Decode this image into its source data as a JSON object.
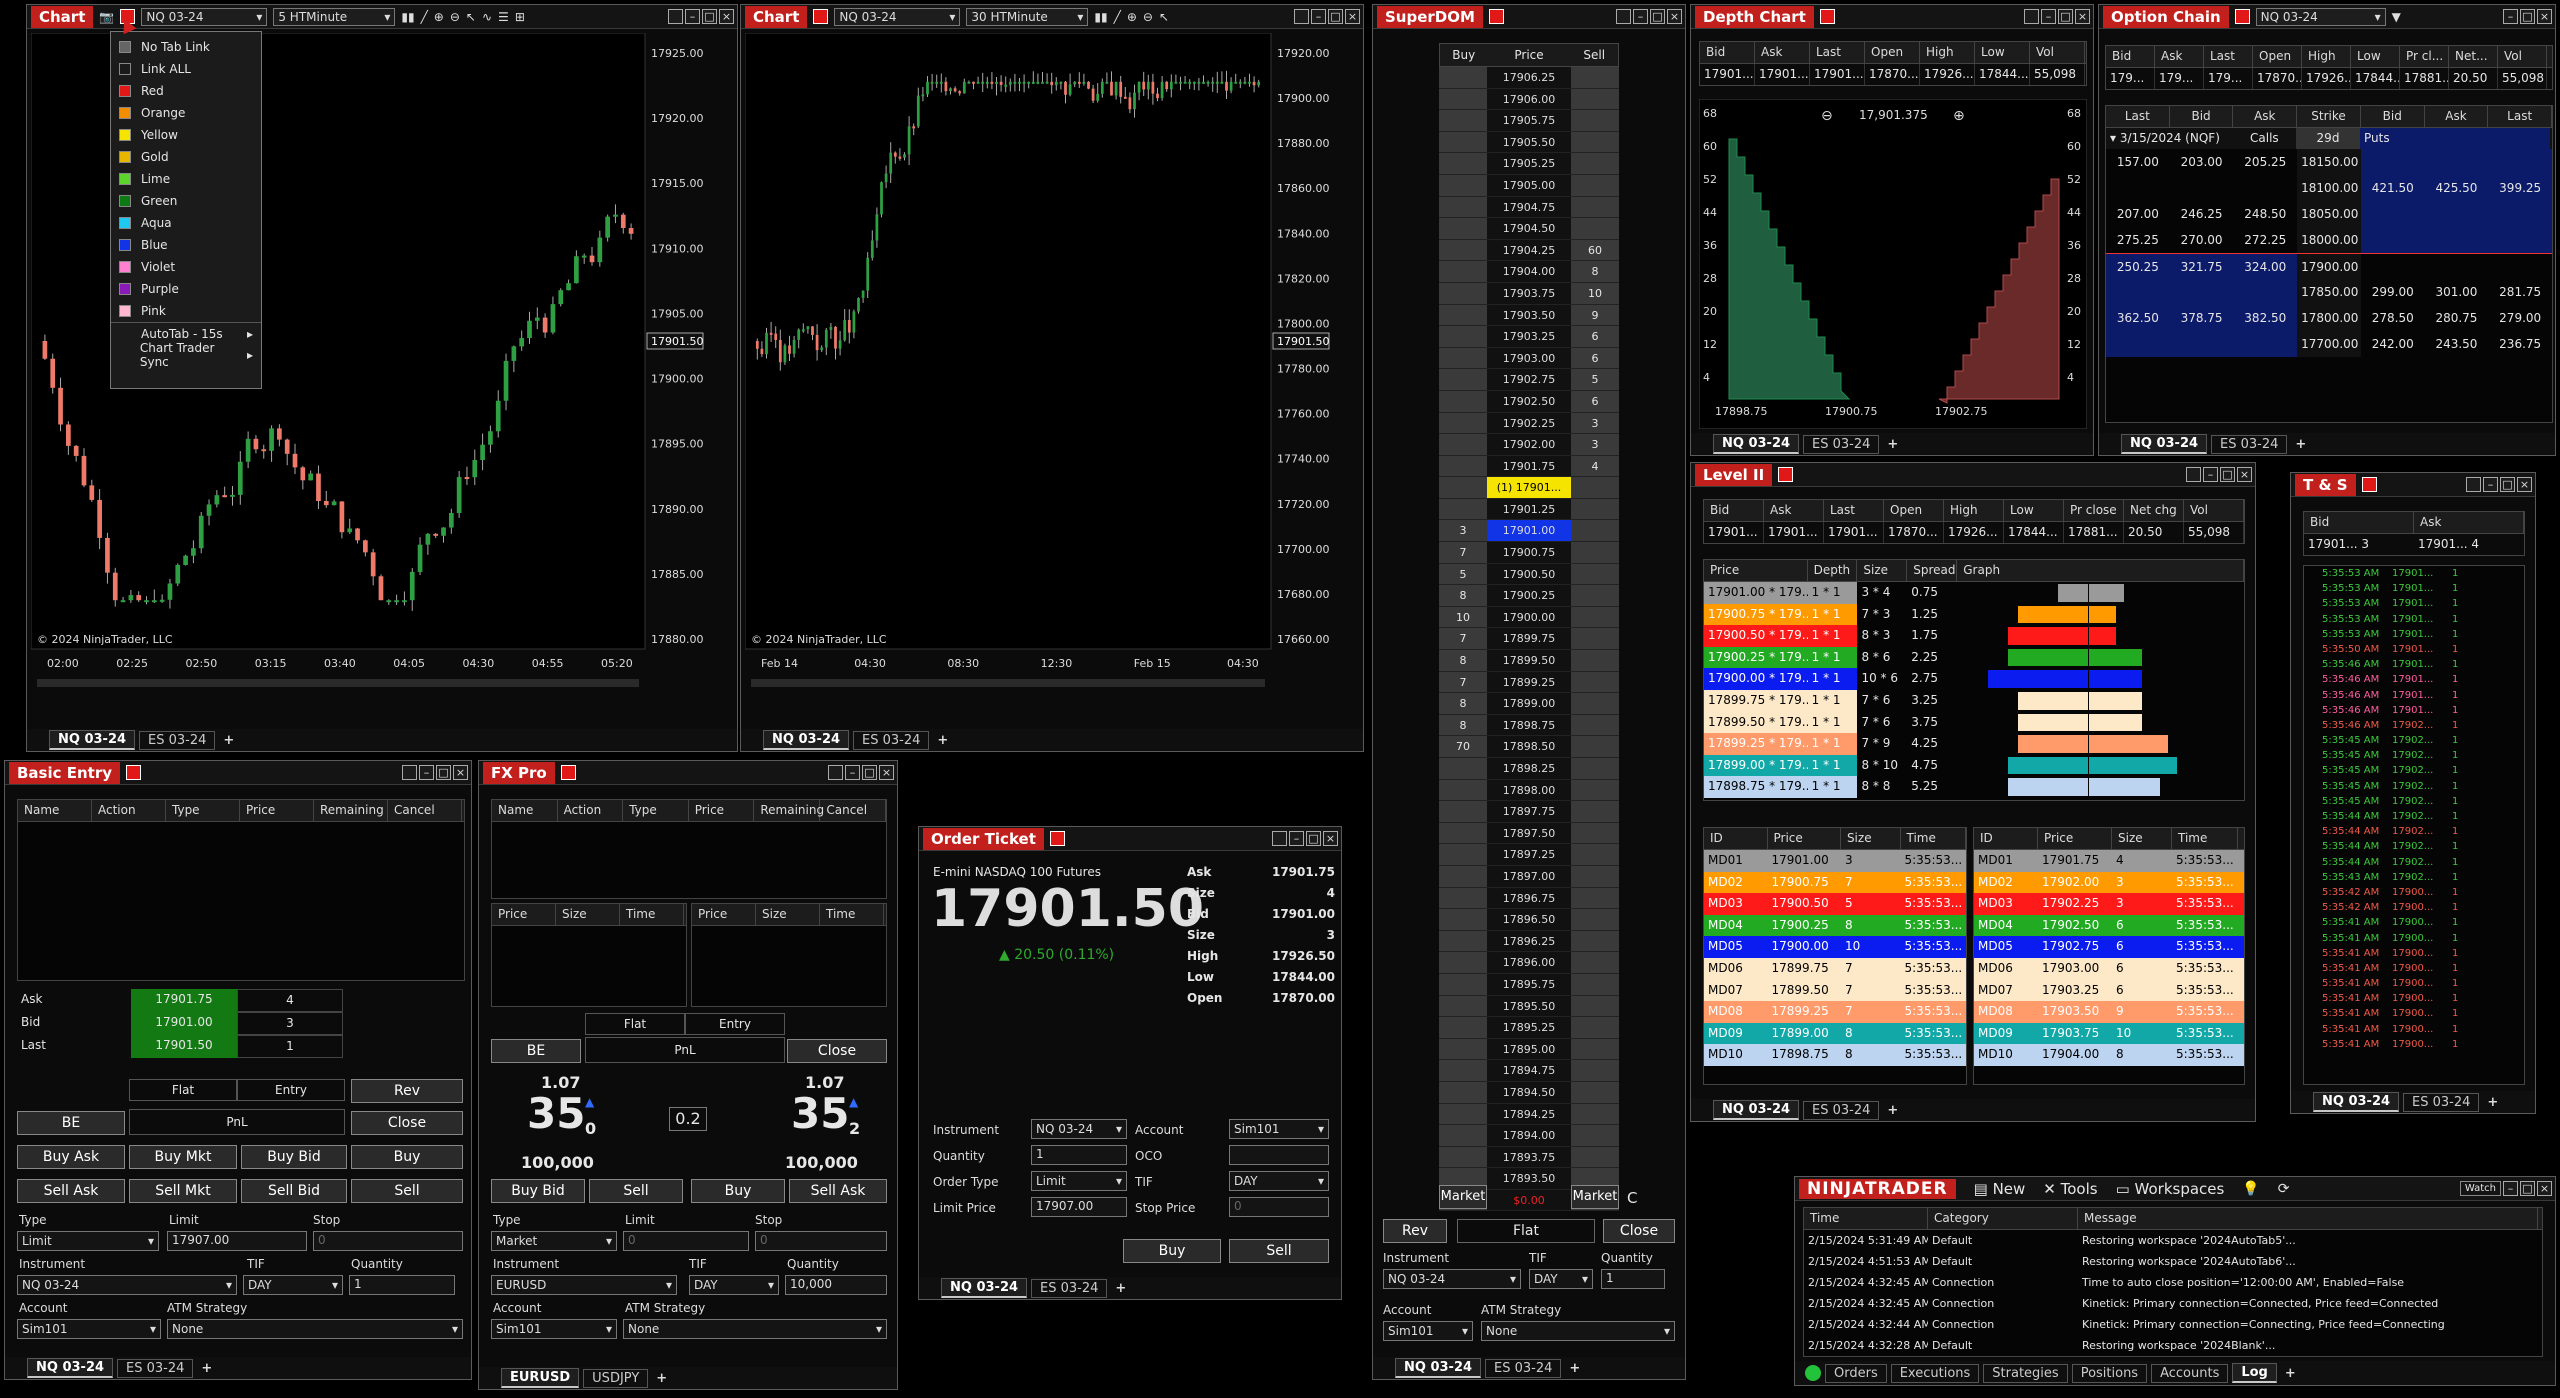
{
  "chart1": {
    "title": "Chart",
    "instrument": "NQ 03-24",
    "interval": "5 HTMinute",
    "copyright": "© 2024 NinjaTrader, LLC",
    "price_ticks": [
      "17925.00",
      "17920.00",
      "17915.00",
      "17910.00",
      "17905.00",
      "17900.00",
      "17895.00",
      "17890.00",
      "17885.00",
      "17880.00"
    ],
    "current": "17901.50",
    "time_ticks": [
      "02:00",
      "02:25",
      "02:50",
      "03:15",
      "03:40",
      "04:05",
      "04:30",
      "04:55",
      "05:20"
    ],
    "tabs": [
      "NQ 03-24",
      "ES 03-24"
    ],
    "menu": [
      "No Tab Link",
      "Link ALL",
      "Red",
      "Orange",
      "Yellow",
      "Gold",
      "Lime",
      "Green",
      "Aqua",
      "Blue",
      "Violet",
      "Purple",
      "Pink",
      "AutoTab - 15s",
      "Chart Trader Sync"
    ],
    "menu_colors": [
      "#666",
      "#1a1a1a",
      "#e01818",
      "#f28c00",
      "#f5e400",
      "#e7b600",
      "#5bd42b",
      "#0e7a16",
      "#1fc8f0",
      "#1034e6",
      "#ff7fd0",
      "#8a1bb8",
      "#ffb7d0",
      "",
      ""
    ]
  },
  "chart2": {
    "title": "Chart",
    "instrument": "NQ 03-24",
    "interval": "30 HTMinute",
    "copyright": "© 2024 NinjaTrader, LLC",
    "price_ticks": [
      "17920.00",
      "17900.00",
      "17880.00",
      "17860.00",
      "17840.00",
      "17820.00",
      "17800.00",
      "17780.00",
      "17760.00",
      "17740.00",
      "17720.00",
      "17700.00",
      "17680.00",
      "17660.00"
    ],
    "current": "17901.50",
    "time_ticks": [
      "Feb 14",
      "04:30",
      "08:30",
      "12:30",
      "Feb 15",
      "04:30"
    ],
    "tabs": [
      "NQ 03-24",
      "ES 03-24"
    ]
  },
  "superdom": {
    "title": "SuperDOM",
    "headers": [
      "Buy",
      "Price",
      "Sell"
    ],
    "prices": [
      "17906.25",
      "17906.00",
      "17905.75",
      "17905.50",
      "17905.25",
      "17905.00",
      "17904.75",
      "17904.50",
      "17904.25",
      "17904.00",
      "17903.75",
      "17903.50",
      "17903.25",
      "17903.00",
      "17902.75",
      "17902.50",
      "17902.25",
      "17902.00",
      "17901.75",
      "(1) 17901...",
      "17901.25",
      "17901.00",
      "17900.75",
      "17900.50",
      "17900.25",
      "17900.00",
      "17899.75",
      "17899.50",
      "17899.25",
      "17899.00",
      "17898.75",
      "17898.50",
      "17898.25",
      "17898.00",
      "17897.75",
      "17897.50",
      "17897.25",
      "17897.00",
      "17896.75",
      "17896.50",
      "17896.25",
      "17896.00",
      "17895.75",
      "17895.50",
      "17895.25",
      "17895.00",
      "17894.75",
      "17894.50",
      "17894.25",
      "17894.00",
      "17893.75",
      "17893.50",
      "$0.00"
    ],
    "sell": [
      "",
      "",
      "",
      "",
      "",
      "",
      "",
      "",
      "60",
      "8",
      "10",
      "9",
      "6",
      "6",
      "5",
      "6",
      "3",
      "3",
      "4",
      "",
      "",
      "",
      "",
      "",
      "",
      "",
      "",
      "",
      "",
      "",
      "",
      "",
      "",
      "",
      "",
      "",
      "",
      "",
      "",
      "",
      "",
      "",
      "",
      "",
      "",
      "",
      "",
      "",
      "",
      "",
      "",
      "",
      ""
    ],
    "buy": [
      "",
      "",
      "",
      "",
      "",
      "",
      "",
      "",
      "",
      "",
      "",
      "",
      "",
      "",
      "",
      "",
      "",
      "",
      "",
      "",
      "",
      "3",
      "7",
      "5",
      "8",
      "10",
      "7",
      "8",
      "7",
      "8",
      "8",
      "70",
      "",
      "",
      "",
      "",
      "",
      "",
      "",
      "",
      "",
      "",
      "",
      "",
      "",
      "",
      "",
      "",
      "",
      "",
      "",
      "",
      ""
    ],
    "market": "Market",
    "rev": "Rev",
    "flat": "Flat",
    "close": "Close",
    "c": "C",
    "instrument_label": "Instrument",
    "tif_label": "TIF",
    "qty_label": "Quantity",
    "instrument": "NQ 03-24",
    "tif": "DAY",
    "qty": "1",
    "account_label": "Account",
    "atm_label": "ATM Strategy",
    "account": "Sim101",
    "atm": "None",
    "tabs": [
      "NQ 03-24",
      "ES 03-24"
    ]
  },
  "depth": {
    "title": "Depth Chart",
    "headers": [
      "Bid",
      "Ask",
      "Last",
      "Open",
      "High",
      "Low",
      "Vol"
    ],
    "values": [
      "17901...",
      "17901...",
      "17901...",
      "17870...",
      "17926...",
      "17844...",
      "55,098"
    ],
    "center": "17,901.375",
    "yticks": [
      "68",
      "60",
      "52",
      "44",
      "36",
      "28",
      "20",
      "12",
      "4"
    ],
    "xticks": [
      "17898.75",
      "17900.75",
      "17902.75"
    ],
    "tabs": [
      "NQ 03-24",
      "ES 03-24"
    ]
  },
  "option": {
    "title": "Option Chain",
    "instrument": "NQ 03-24",
    "headers": [
      "Bid",
      "Ask",
      "Last",
      "Open",
      "High",
      "Low",
      "Pr cl...",
      "Net...",
      "Vol"
    ],
    "values": [
      "179...",
      "179...",
      "179...",
      "17870...",
      "17926...",
      "17844...",
      "17881...",
      "20.50",
      "55,098"
    ],
    "chain_headers": [
      "Last",
      "Bid",
      "Ask",
      "Strike",
      "Bid",
      "Ask",
      "Last"
    ],
    "expiry": "3/15/2024 (NQF)",
    "calls": "Calls",
    "days": "29d",
    "puts": "Puts",
    "rows": [
      [
        "157.00",
        "203.00",
        "205.25",
        "18150.00",
        "",
        "",
        ""
      ],
      [
        "",
        "",
        "",
        "18100.00",
        "421.50",
        "425.50",
        "399.25"
      ],
      [
        "207.00",
        "246.25",
        "248.50",
        "18050.00",
        "",
        "",
        ""
      ],
      [
        "275.25",
        "270.00",
        "272.25",
        "18000.00",
        "",
        "",
        ""
      ],
      [
        "250.25",
        "321.75",
        "324.00",
        "17900.00",
        "",
        "",
        ""
      ],
      [
        "",
        "",
        "",
        "17850.00",
        "299.00",
        "301.00",
        "281.75"
      ],
      [
        "362.50",
        "378.75",
        "382.50",
        "17800.00",
        "278.50",
        "280.75",
        "279.00"
      ],
      [
        "",
        "",
        "",
        "17700.00",
        "242.00",
        "243.50",
        "236.75"
      ]
    ],
    "tabs": [
      "NQ 03-24",
      "ES 03-24"
    ]
  },
  "level2": {
    "title": "Level II",
    "headers": [
      "Bid",
      "Ask",
      "Last",
      "Open",
      "High",
      "Low",
      "Pr close",
      "Net chg",
      "Vol"
    ],
    "values": [
      "17901...",
      "17901...",
      "17901...",
      "17870...",
      "17926...",
      "17844...",
      "17881...",
      "20.50",
      "55,098"
    ],
    "book_headers": [
      "Price",
      "Depth",
      "Size",
      "Spread",
      "Graph"
    ],
    "book": [
      [
        "17901.00 * 179...",
        "1 * 1",
        "3 * 4",
        "0.75"
      ],
      [
        "17900.75 * 179...",
        "1 * 1",
        "7 * 3",
        "1.25"
      ],
      [
        "17900.50 * 179...",
        "1 * 1",
        "8 * 3",
        "1.75"
      ],
      [
        "17900.25 * 179...",
        "1 * 1",
        "8 * 6",
        "2.25"
      ],
      [
        "17900.00 * 179...",
        "1 * 1",
        "10 * 6",
        "2.75"
      ],
      [
        "17899.75 * 179...",
        "1 * 1",
        "7 * 6",
        "3.25"
      ],
      [
        "17899.50 * 179...",
        "1 * 1",
        "7 * 6",
        "3.75"
      ],
      [
        "17899.25 * 179...",
        "1 * 1",
        "7 * 9",
        "4.25"
      ],
      [
        "17899.00 * 179...",
        "1 * 1",
        "8 * 10",
        "4.75"
      ],
      [
        "17898.75 * 179...",
        "1 * 1",
        "8 * 8",
        "5.25"
      ]
    ],
    "mm_headers": [
      "ID",
      "Price",
      "Size",
      "Time"
    ],
    "bids": [
      [
        "MD01",
        "17901.00",
        "3",
        "5:35:53..."
      ],
      [
        "MD02",
        "17900.75",
        "7",
        "5:35:53..."
      ],
      [
        "MD03",
        "17900.50",
        "5",
        "5:35:53..."
      ],
      [
        "MD04",
        "17900.25",
        "8",
        "5:35:53..."
      ],
      [
        "MD05",
        "17900.00",
        "10",
        "5:35:53..."
      ],
      [
        "MD06",
        "17899.75",
        "7",
        "5:35:53..."
      ],
      [
        "MD07",
        "17899.50",
        "7",
        "5:35:53..."
      ],
      [
        "MD08",
        "17899.25",
        "7",
        "5:35:53..."
      ],
      [
        "MD09",
        "17899.00",
        "8",
        "5:35:53..."
      ],
      [
        "MD10",
        "17898.75",
        "8",
        "5:35:53..."
      ]
    ],
    "asks": [
      [
        "MD01",
        "17901.75",
        "4",
        "5:35:53..."
      ],
      [
        "MD02",
        "17902.00",
        "3",
        "5:35:53..."
      ],
      [
        "MD03",
        "17902.25",
        "3",
        "5:35:53..."
      ],
      [
        "MD04",
        "17902.50",
        "6",
        "5:35:53..."
      ],
      [
        "MD05",
        "17902.75",
        "6",
        "5:35:53..."
      ],
      [
        "MD06",
        "17903.00",
        "6",
        "5:35:53..."
      ],
      [
        "MD07",
        "17903.25",
        "6",
        "5:35:53..."
      ],
      [
        "MD08",
        "17903.50",
        "9",
        "5:35:53..."
      ],
      [
        "MD09",
        "17903.75",
        "10",
        "5:35:53..."
      ],
      [
        "MD10",
        "17904.00",
        "8",
        "5:35:53..."
      ]
    ],
    "colors": [
      "#9a9a9a",
      "#ff9a00",
      "#ff1a1a",
      "#22aa22",
      "#0b1cf0",
      "#fde9c8",
      "#fde9c8",
      "#ff9a6a",
      "#12a8a8",
      "#bcd4f0"
    ],
    "tabs": [
      "NQ 03-24",
      "ES 03-24"
    ]
  },
  "ts": {
    "title": "T & S",
    "headers": [
      "Bid",
      "Ask"
    ],
    "bid": "17901... 3",
    "ask": "17901... 4",
    "rows": [
      [
        "5:35:53 AM",
        "17901...",
        "1",
        "g"
      ],
      [
        "5:35:53 AM",
        "17901...",
        "1",
        "g"
      ],
      [
        "5:35:53 AM",
        "17901...",
        "1",
        "g"
      ],
      [
        "5:35:53 AM",
        "17901...",
        "1",
        "g"
      ],
      [
        "5:35:53 AM",
        "17901...",
        "1",
        "g"
      ],
      [
        "5:35:50 AM",
        "17901...",
        "1",
        "r"
      ],
      [
        "5:35:46 AM",
        "17901...",
        "1",
        "g"
      ],
      [
        "5:35:46 AM",
        "17901...",
        "1",
        "p"
      ],
      [
        "5:35:46 AM",
        "17901...",
        "1",
        "p"
      ],
      [
        "5:35:46 AM",
        "17901...",
        "1",
        "p"
      ],
      [
        "5:35:46 AM",
        "17902...",
        "1",
        "r"
      ],
      [
        "5:35:45 AM",
        "17902...",
        "1",
        "g"
      ],
      [
        "5:35:45 AM",
        "17902...",
        "1",
        "g"
      ],
      [
        "5:35:45 AM",
        "17902...",
        "1",
        "g"
      ],
      [
        "5:35:45 AM",
        "17902...",
        "1",
        "g"
      ],
      [
        "5:35:45 AM",
        "17902...",
        "1",
        "g"
      ],
      [
        "5:35:44 AM",
        "17902...",
        "1",
        "g"
      ],
      [
        "5:35:44 AM",
        "17902...",
        "1",
        "r"
      ],
      [
        "5:35:44 AM",
        "17902...",
        "1",
        "g"
      ],
      [
        "5:35:44 AM",
        "17902...",
        "1",
        "g"
      ],
      [
        "5:35:43 AM",
        "17902...",
        "1",
        "g"
      ],
      [
        "5:35:42 AM",
        "17900...",
        "1",
        "r"
      ],
      [
        "5:35:42 AM",
        "17900...",
        "1",
        "r"
      ],
      [
        "5:35:41 AM",
        "17900...",
        "1",
        "g"
      ],
      [
        "5:35:41 AM",
        "17900...",
        "1",
        "g"
      ],
      [
        "5:35:41 AM",
        "17900...",
        "1",
        "r"
      ],
      [
        "5:35:41 AM",
        "17900...",
        "1",
        "r"
      ],
      [
        "5:35:41 AM",
        "17900...",
        "1",
        "r"
      ],
      [
        "5:35:41 AM",
        "17900...",
        "1",
        "r"
      ],
      [
        "5:35:41 AM",
        "17900...",
        "1",
        "r"
      ],
      [
        "5:35:41 AM",
        "17900...",
        "1",
        "r"
      ],
      [
        "5:35:41 AM",
        "17900...",
        "1",
        "r"
      ]
    ],
    "tabs": [
      "NQ 03-24",
      "ES 03-24"
    ]
  },
  "basic": {
    "title": "Basic Entry",
    "headers": [
      "Name",
      "Action",
      "Type",
      "Price",
      "Remaining",
      "Cancel"
    ],
    "ask_l": "Ask",
    "bid_l": "Bid",
    "last_l": "Last",
    "ask": "17901.75",
    "ask_s": "4",
    "bid": "17901.00",
    "bid_s": "3",
    "last": "17901.50",
    "last_s": "1",
    "flat": "Flat",
    "entry": "Entry",
    "rev": "Rev",
    "be": "BE",
    "pnl": "PnL",
    "close": "Close",
    "buy_ask": "Buy Ask",
    "buy_mkt": "Buy Mkt",
    "buy_bid": "Buy Bid",
    "buy": "Buy",
    "sell_ask": "Sell Ask",
    "sell_mkt": "Sell Mkt",
    "sell_bid": "Sell Bid",
    "sell": "Sell",
    "type_l": "Type",
    "limit_l": "Limit",
    "stop_l": "Stop",
    "type": "Limit",
    "limit": "17907.00",
    "stop": "0",
    "instrument_l": "Instrument",
    "tif_l": "TIF",
    "qty_l": "Quantity",
    "instrument": "NQ 03-24",
    "tif": "DAY",
    "qty": "1",
    "account_l": "Account",
    "atm_l": "ATM Strategy",
    "account": "Sim101",
    "atm": "None",
    "tabs": [
      "NQ 03-24",
      "ES 03-24"
    ]
  },
  "fx": {
    "title": "FX Pro",
    "headers": [
      "Name",
      "Action",
      "Type",
      "Price",
      "Remaining",
      "Cancel"
    ],
    "sub_headers": [
      "Price",
      "Size",
      "Time"
    ],
    "flat": "Flat",
    "entry": "Entry",
    "be": "BE",
    "pnl": "PnL",
    "close": "Close",
    "left_big": "1.07",
    "left_pip": "35",
    "left_frac": "0",
    "spread": "0.2",
    "right_big": "1.07",
    "right_pip": "35",
    "right_frac": "2",
    "left_vol": "100,000",
    "right_vol": "100,000",
    "buy_bid": "Buy Bid",
    "sell": "Sell",
    "buy": "Buy",
    "sell_ask": "Sell Ask",
    "type_l": "Type",
    "limit_l": "Limit",
    "stop_l": "Stop",
    "type": "Market",
    "limit": "0",
    "stop": "0",
    "instrument_l": "Instrument",
    "tif_l": "TIF",
    "qty_l": "Quantity",
    "instrument": "EURUSD",
    "tif": "DAY",
    "qty": "10,000",
    "account_l": "Account",
    "atm_l": "ATM Strategy",
    "account": "Sim101",
    "atm": "None",
    "tabs": [
      "EURUSD",
      "USDJPY"
    ]
  },
  "ticket": {
    "title": "Order Ticket",
    "name": "E-mini NASDAQ 100 Futures",
    "price": "17901.50",
    "change": "▲ 20.50 (0.11%)",
    "ask_l": "Ask",
    "ask": "17901.75",
    "size_l": "Size",
    "ask_s": "4",
    "bid_l": "Bid",
    "bid": "17901.00",
    "bid_s": "3",
    "high_l": "High",
    "high": "17926.50",
    "low_l": "Low",
    "low": "17844.00",
    "open_l": "Open",
    "open": "17870.00",
    "instrument_l": "Instrument",
    "instrument": "NQ 03-24",
    "account_l": "Account",
    "account": "Sim101",
    "qty_l": "Quantity",
    "qty": "1",
    "oco_l": "OCO",
    "ot_l": "Order Type",
    "ot": "Limit",
    "tif_l": "TIF",
    "tif": "DAY",
    "lp_l": "Limit Price",
    "lp": "17907.00",
    "sp_l": "Stop Price",
    "sp": "0",
    "buy": "Buy",
    "sell": "Sell",
    "tabs": [
      "NQ 03-24",
      "ES 03-24"
    ]
  },
  "cc": {
    "brand": "NINJATRADER",
    "menu": [
      "New",
      "Tools",
      "Workspaces"
    ],
    "watch": "Watch",
    "headers": [
      "Time",
      "Category",
      "Message"
    ],
    "log": [
      [
        "2/15/2024 5:31:49 AM",
        "Default",
        "Restoring workspace '2024AutoTab5'..."
      ],
      [
        "2/15/2024 4:51:53 AM",
        "Default",
        "Restoring workspace '2024AutoTab6'..."
      ],
      [
        "2/15/2024 4:32:45 AM",
        "Connection",
        "Time to auto close position='12:00:00 AM', Enabled=False"
      ],
      [
        "2/15/2024 4:32:45 AM",
        "Connection",
        "Kinetick: Primary connection=Connected, Price feed=Connected"
      ],
      [
        "2/15/2024 4:32:44 AM",
        "Connection",
        "Kinetick: Primary connection=Connecting, Price feed=Connecting"
      ],
      [
        "2/15/2024 4:32:28 AM",
        "Default",
        "Restoring workspace '2024Blank'..."
      ]
    ],
    "tabs": [
      "Orders",
      "Executions",
      "Strategies",
      "Positions",
      "Accounts",
      "Log"
    ]
  }
}
